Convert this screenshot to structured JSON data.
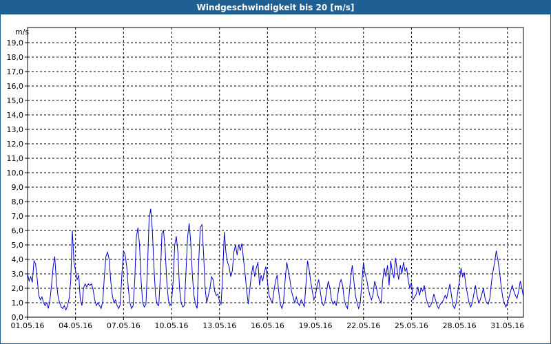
{
  "window": {
    "title": "Windgeschwindigkeit bis 20 [m/s]"
  },
  "chart_data": {
    "type": "line",
    "title": "Windgeschwindigkeit bis 20 [m/s]",
    "ylabel": "m/s",
    "xlabel": "",
    "ylim": [
      0,
      20
    ],
    "xlim_days": [
      0,
      31
    ],
    "grid": true,
    "y_ticks": [
      "0,0",
      "1,0",
      "2,0",
      "3,0",
      "4,0",
      "5,0",
      "6,0",
      "7,0",
      "8,0",
      "9,0",
      "10,0",
      "11,0",
      "12,0",
      "13,0",
      "14,0",
      "15,0",
      "16,0",
      "17,0",
      "18,0",
      "19,0"
    ],
    "x_ticks": [
      "01.05.16",
      "04.05.16",
      "07.05.16",
      "10.05.16",
      "13.05.16",
      "16.05.16",
      "19.05.16",
      "22.05.16",
      "25.05.16",
      "28.05.16",
      "31.05.16"
    ],
    "x_tick_days": [
      0,
      3,
      6,
      9,
      12,
      15,
      18,
      21,
      24,
      27,
      30
    ],
    "series": [
      {
        "color": "#0000cc",
        "points": [
          [
            0.0,
            3.0
          ],
          [
            0.1,
            2.5
          ],
          [
            0.2,
            2.8
          ],
          [
            0.3,
            2.4
          ],
          [
            0.4,
            3.9
          ],
          [
            0.5,
            3.7
          ],
          [
            0.6,
            2.7
          ],
          [
            0.7,
            1.5
          ],
          [
            0.8,
            1.2
          ],
          [
            0.9,
            1.4
          ],
          [
            1.0,
            1.0
          ],
          [
            1.1,
            0.8
          ],
          [
            1.2,
            1.0
          ],
          [
            1.3,
            0.6
          ],
          [
            1.4,
            1.2
          ],
          [
            1.5,
            2.2
          ],
          [
            1.6,
            3.5
          ],
          [
            1.7,
            4.2
          ],
          [
            1.8,
            2.5
          ],
          [
            1.9,
            1.5
          ],
          [
            2.0,
            1.0
          ],
          [
            2.1,
            0.7
          ],
          [
            2.2,
            0.6
          ],
          [
            2.3,
            0.8
          ],
          [
            2.4,
            0.5
          ],
          [
            2.5,
            0.8
          ],
          [
            2.6,
            1.3
          ],
          [
            2.7,
            2.5
          ],
          [
            2.8,
            6.0
          ],
          [
            2.9,
            3.8
          ],
          [
            3.0,
            3.2
          ],
          [
            3.1,
            2.6
          ],
          [
            3.2,
            2.9
          ],
          [
            3.3,
            1.2
          ],
          [
            3.4,
            0.8
          ],
          [
            3.5,
            2.0
          ],
          [
            3.6,
            2.3
          ],
          [
            3.7,
            2.1
          ],
          [
            3.8,
            2.3
          ],
          [
            3.9,
            2.2
          ],
          [
            4.0,
            2.3
          ],
          [
            4.1,
            1.9
          ],
          [
            4.2,
            1.2
          ],
          [
            4.3,
            0.8
          ],
          [
            4.4,
            1.0
          ],
          [
            4.5,
            0.8
          ],
          [
            4.6,
            0.6
          ],
          [
            4.7,
            1.1
          ],
          [
            4.8,
            2.8
          ],
          [
            4.9,
            4.2
          ],
          [
            5.0,
            4.5
          ],
          [
            5.1,
            4.0
          ],
          [
            5.2,
            2.5
          ],
          [
            5.3,
            1.5
          ],
          [
            5.4,
            1.0
          ],
          [
            5.5,
            1.2
          ],
          [
            5.6,
            0.8
          ],
          [
            5.7,
            0.6
          ],
          [
            5.8,
            0.9
          ],
          [
            5.9,
            3.0
          ],
          [
            6.0,
            4.6
          ],
          [
            6.1,
            4.3
          ],
          [
            6.2,
            3.5
          ],
          [
            6.3,
            2.0
          ],
          [
            6.4,
            1.0
          ],
          [
            6.5,
            0.6
          ],
          [
            6.6,
            0.8
          ],
          [
            6.7,
            2.5
          ],
          [
            6.8,
            5.5
          ],
          [
            6.9,
            6.2
          ],
          [
            7.0,
            5.0
          ],
          [
            7.1,
            2.5
          ],
          [
            7.2,
            1.0
          ],
          [
            7.3,
            0.7
          ],
          [
            7.4,
            0.9
          ],
          [
            7.5,
            3.5
          ],
          [
            7.6,
            6.8
          ],
          [
            7.7,
            7.5
          ],
          [
            7.8,
            6.0
          ],
          [
            7.9,
            3.5
          ],
          [
            8.0,
            1.5
          ],
          [
            8.1,
            0.9
          ],
          [
            8.2,
            0.8
          ],
          [
            8.3,
            2.8
          ],
          [
            8.4,
            5.8
          ],
          [
            8.5,
            6.0
          ],
          [
            8.6,
            4.8
          ],
          [
            8.7,
            2.5
          ],
          [
            8.8,
            1.2
          ],
          [
            8.9,
            0.8
          ],
          [
            9.0,
            1.0
          ],
          [
            9.1,
            2.5
          ],
          [
            9.2,
            5.0
          ],
          [
            9.3,
            5.6
          ],
          [
            9.4,
            4.5
          ],
          [
            9.5,
            2.0
          ],
          [
            9.6,
            1.0
          ],
          [
            9.7,
            0.7
          ],
          [
            9.8,
            0.8
          ],
          [
            9.9,
            3.0
          ],
          [
            10.0,
            5.5
          ],
          [
            10.1,
            6.5
          ],
          [
            10.2,
            5.2
          ],
          [
            10.3,
            3.0
          ],
          [
            10.4,
            1.5
          ],
          [
            10.5,
            0.9
          ],
          [
            10.6,
            0.6
          ],
          [
            10.7,
            3.8
          ],
          [
            10.8,
            6.2
          ],
          [
            10.9,
            6.4
          ],
          [
            11.0,
            4.5
          ],
          [
            11.1,
            2.0
          ],
          [
            11.2,
            1.0
          ],
          [
            11.3,
            1.5
          ],
          [
            11.4,
            2.0
          ],
          [
            11.5,
            2.8
          ],
          [
            11.6,
            2.6
          ],
          [
            11.7,
            1.8
          ],
          [
            11.8,
            1.5
          ],
          [
            11.9,
            1.6
          ],
          [
            12.0,
            1.1
          ],
          [
            12.1,
            0.9
          ],
          [
            12.2,
            3.0
          ],
          [
            12.3,
            5.9
          ],
          [
            12.4,
            4.5
          ],
          [
            12.5,
            3.8
          ],
          [
            12.6,
            3.5
          ],
          [
            12.7,
            2.8
          ],
          [
            12.8,
            3.2
          ],
          [
            12.9,
            4.5
          ],
          [
            13.0,
            5.0
          ],
          [
            13.1,
            4.3
          ],
          [
            13.2,
            5.0
          ],
          [
            13.3,
            4.6
          ],
          [
            13.4,
            5.1
          ],
          [
            13.5,
            4.0
          ],
          [
            13.6,
            3.0
          ],
          [
            13.7,
            1.8
          ],
          [
            13.8,
            0.9
          ],
          [
            13.9,
            2.0
          ],
          [
            14.0,
            3.0
          ],
          [
            14.1,
            3.6
          ],
          [
            14.2,
            2.8
          ],
          [
            14.3,
            3.4
          ],
          [
            14.4,
            3.8
          ],
          [
            14.5,
            2.2
          ],
          [
            14.6,
            2.9
          ],
          [
            14.7,
            2.5
          ],
          [
            14.8,
            3.1
          ],
          [
            14.9,
            3.5
          ],
          [
            15.0,
            2.4
          ],
          [
            15.1,
            1.5
          ],
          [
            15.2,
            1.2
          ],
          [
            15.3,
            1.0
          ],
          [
            15.4,
            1.8
          ],
          [
            15.5,
            2.5
          ],
          [
            15.6,
            2.9
          ],
          [
            15.7,
            1.8
          ],
          [
            15.8,
            0.9
          ],
          [
            15.9,
            0.6
          ],
          [
            16.0,
            1.0
          ],
          [
            16.1,
            2.5
          ],
          [
            16.2,
            3.8
          ],
          [
            16.3,
            3.2
          ],
          [
            16.4,
            2.6
          ],
          [
            16.5,
            1.8
          ],
          [
            16.6,
            1.4
          ],
          [
            16.7,
            1.0
          ],
          [
            16.8,
            1.4
          ],
          [
            16.9,
            1.0
          ],
          [
            17.0,
            0.8
          ],
          [
            17.1,
            1.2
          ],
          [
            17.2,
            1.0
          ],
          [
            17.3,
            0.7
          ],
          [
            17.4,
            2.2
          ],
          [
            17.5,
            3.9
          ],
          [
            17.6,
            3.3
          ],
          [
            17.7,
            2.5
          ],
          [
            17.8,
            1.8
          ],
          [
            17.9,
            1.2
          ],
          [
            18.0,
            1.5
          ],
          [
            18.1,
            2.2
          ],
          [
            18.2,
            2.6
          ],
          [
            18.3,
            1.8
          ],
          [
            18.4,
            1.0
          ],
          [
            18.5,
            0.8
          ],
          [
            18.6,
            1.1
          ],
          [
            18.7,
            1.8
          ],
          [
            18.8,
            2.5
          ],
          [
            18.9,
            2.0
          ],
          [
            19.0,
            1.2
          ],
          [
            19.1,
            0.9
          ],
          [
            19.2,
            1.1
          ],
          [
            19.3,
            0.8
          ],
          [
            19.4,
            1.6
          ],
          [
            19.5,
            2.3
          ],
          [
            19.6,
            2.6
          ],
          [
            19.7,
            2.2
          ],
          [
            19.8,
            1.2
          ],
          [
            19.9,
            0.8
          ],
          [
            20.0,
            0.6
          ],
          [
            20.1,
            1.5
          ],
          [
            20.2,
            2.8
          ],
          [
            20.3,
            3.6
          ],
          [
            20.4,
            2.5
          ],
          [
            20.5,
            1.5
          ],
          [
            20.6,
            1.0
          ],
          [
            20.7,
            0.6
          ],
          [
            20.8,
            1.0
          ],
          [
            20.9,
            2.4
          ],
          [
            21.0,
            3.8
          ],
          [
            21.1,
            3.0
          ],
          [
            21.2,
            2.6
          ],
          [
            21.3,
            2.0
          ],
          [
            21.4,
            1.5
          ],
          [
            21.5,
            1.2
          ],
          [
            21.6,
            1.6
          ],
          [
            21.7,
            2.5
          ],
          [
            21.8,
            2.1
          ],
          [
            21.9,
            1.5
          ],
          [
            22.0,
            1.2
          ],
          [
            22.1,
            1.0
          ],
          [
            22.2,
            2.5
          ],
          [
            22.3,
            3.4
          ],
          [
            22.4,
            2.8
          ],
          [
            22.5,
            3.6
          ],
          [
            22.6,
            2.2
          ],
          [
            22.7,
            3.9
          ],
          [
            22.8,
            3.2
          ],
          [
            22.9,
            2.7
          ],
          [
            23.0,
            4.1
          ],
          [
            23.1,
            3.3
          ],
          [
            23.2,
            2.6
          ],
          [
            23.3,
            3.6
          ],
          [
            23.4,
            3.0
          ],
          [
            23.5,
            3.8
          ],
          [
            23.6,
            3.2
          ],
          [
            23.7,
            3.4
          ],
          [
            23.8,
            2.5
          ],
          [
            23.9,
            2.0
          ],
          [
            24.0,
            2.4
          ],
          [
            24.1,
            1.2
          ],
          [
            24.2,
            1.4
          ],
          [
            24.3,
            1.6
          ],
          [
            24.4,
            2.1
          ],
          [
            24.5,
            1.5
          ],
          [
            24.6,
            2.0
          ],
          [
            24.7,
            1.8
          ],
          [
            24.8,
            2.2
          ],
          [
            24.9,
            1.4
          ],
          [
            25.0,
            1.0
          ],
          [
            25.1,
            0.7
          ],
          [
            25.2,
            0.8
          ],
          [
            25.3,
            1.1
          ],
          [
            25.4,
            1.6
          ],
          [
            25.5,
            1.2
          ],
          [
            25.6,
            0.8
          ],
          [
            25.7,
            0.6
          ],
          [
            25.8,
            0.9
          ],
          [
            25.9,
            1.0
          ],
          [
            26.0,
            1.2
          ],
          [
            26.1,
            1.5
          ],
          [
            26.2,
            1.3
          ],
          [
            26.3,
            1.8
          ],
          [
            26.4,
            2.3
          ],
          [
            26.5,
            1.5
          ],
          [
            26.6,
            0.8
          ],
          [
            26.7,
            0.6
          ],
          [
            26.8,
            1.0
          ],
          [
            26.9,
            1.8
          ],
          [
            27.0,
            2.5
          ],
          [
            27.1,
            3.4
          ],
          [
            27.2,
            2.8
          ],
          [
            27.3,
            3.1
          ],
          [
            27.4,
            2.2
          ],
          [
            27.5,
            1.6
          ],
          [
            27.6,
            1.0
          ],
          [
            27.7,
            0.7
          ],
          [
            27.8,
            1.0
          ],
          [
            27.9,
            1.6
          ],
          [
            28.0,
            2.2
          ],
          [
            28.1,
            1.5
          ],
          [
            28.2,
            1.0
          ],
          [
            28.3,
            1.2
          ],
          [
            28.4,
            1.6
          ],
          [
            28.5,
            2.0
          ],
          [
            28.6,
            1.3
          ],
          [
            28.7,
            1.0
          ],
          [
            28.8,
            0.9
          ],
          [
            28.9,
            1.3
          ],
          [
            29.0,
            2.4
          ],
          [
            29.1,
            3.2
          ],
          [
            29.2,
            3.8
          ],
          [
            29.3,
            4.6
          ],
          [
            29.4,
            4.0
          ],
          [
            29.5,
            3.2
          ],
          [
            29.6,
            2.2
          ],
          [
            29.7,
            1.4
          ],
          [
            29.8,
            1.0
          ],
          [
            29.9,
            0.7
          ],
          [
            30.0,
            1.0
          ],
          [
            30.1,
            1.4
          ],
          [
            30.2,
            1.8
          ],
          [
            30.3,
            2.2
          ],
          [
            30.4,
            1.8
          ],
          [
            30.5,
            1.5
          ],
          [
            30.6,
            1.3
          ],
          [
            30.7,
            1.8
          ],
          [
            30.8,
            2.5
          ],
          [
            30.9,
            2.0
          ],
          [
            31.0,
            1.4
          ]
        ]
      }
    ]
  }
}
